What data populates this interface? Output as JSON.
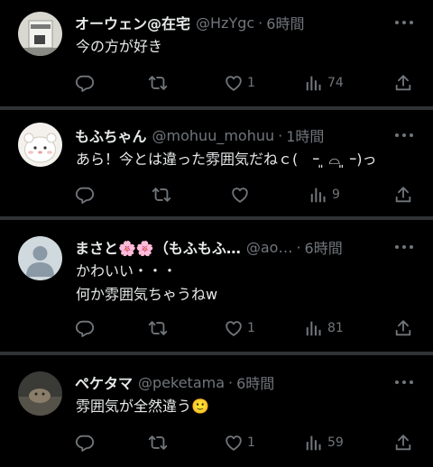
{
  "tweets": [
    {
      "name": "オーウェン@在宅",
      "handle": "@HzYgc",
      "separator": "·",
      "time": "6時間",
      "lines": [
        "今の方が好き"
      ],
      "replies": "",
      "retweets": "",
      "likes": "1",
      "views": "74"
    },
    {
      "name": "もふちゃん",
      "handle": "@mohuu_mohuu",
      "separator": "·",
      "time": "1時間",
      "lines": [
        "あら！今とは違った雰囲気だねｃ(　ｰ ͈ ⌓ ͈ ｰ)っ"
      ],
      "replies": "",
      "retweets": "",
      "likes": "",
      "views": "9"
    },
    {
      "name": "まさと🌸🌸（もふもふ…",
      "handle": "@ao…",
      "separator": "·",
      "time": "6時間",
      "lines": [
        "かわいい・・・",
        "何か雰囲気ちゃうねw"
      ],
      "replies": "",
      "retweets": "",
      "likes": "1",
      "views": "81"
    },
    {
      "name": "ペケタマ",
      "handle": "@peketama",
      "separator": "·",
      "time": "6時間",
      "lines": [
        "雰囲気が全然違う🙂"
      ],
      "replies": "",
      "retweets": "",
      "likes": "1",
      "views": "59"
    }
  ],
  "icons": {
    "reply": "reply-icon",
    "retweet": "retweet-icon",
    "like": "heart-icon",
    "views": "views-icon",
    "share": "share-icon",
    "more": "more-icon"
  },
  "colors": {
    "background": "#000000",
    "text": "#e7e9ea",
    "secondary": "#71767b",
    "divider": "#2f3336"
  }
}
